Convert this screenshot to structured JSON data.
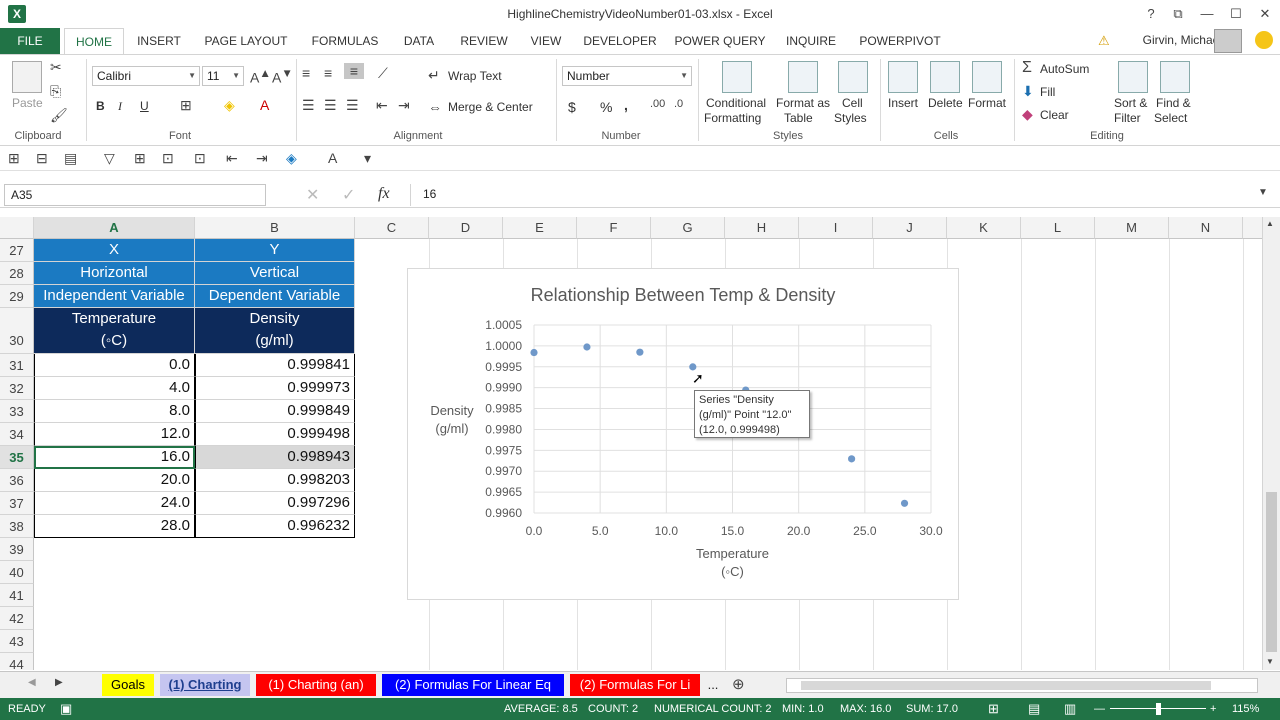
{
  "window": {
    "title": "HighlineChemistryVideoNumber01-03.xlsx - Excel",
    "help": "?",
    "restore": "⧉",
    "minimize": "—",
    "maximize": "☐",
    "close": "✕"
  },
  "ribbon_tabs": {
    "file": "FILE",
    "tabs": [
      "HOME",
      "INSERT",
      "PAGE LAYOUT",
      "FORMULAS",
      "DATA",
      "REVIEW",
      "VIEW",
      "DEVELOPER",
      "POWER QUERY",
      "INQUIRE",
      "POWERPIVOT"
    ],
    "user": "Girvin, Michael"
  },
  "ribbon": {
    "clipboard": {
      "paste": "Paste",
      "label": "Clipboard"
    },
    "font": {
      "name": "Calibri",
      "size": "11",
      "label": "Font",
      "bold": "B",
      "italic": "I",
      "underline": "U"
    },
    "alignment": {
      "wrap": "Wrap Text",
      "merge": "Merge & Center",
      "label": "Alignment"
    },
    "number": {
      "format": "Number",
      "label": "Number",
      "currency": "$",
      "percent": "%",
      "comma": ","
    },
    "styles": {
      "conditional": [
        "Conditional",
        "Formatting"
      ],
      "format_table": [
        "Format as",
        "Table"
      ],
      "cell_styles": [
        "Cell",
        "Styles"
      ],
      "label": "Styles"
    },
    "cells": {
      "insert": "Insert",
      "delete": "Delete",
      "format": "Format",
      "label": "Cells"
    },
    "editing": {
      "autosum": "AutoSum",
      "fill": "Fill",
      "clear": "Clear",
      "sort": [
        "Sort &",
        "Filter"
      ],
      "find": [
        "Find &",
        "Select"
      ],
      "label": "Editing"
    }
  },
  "formula_bar": {
    "name_box": "A35",
    "fx": "fx",
    "value": "16"
  },
  "columns": [
    "A",
    "B",
    "C",
    "D",
    "E",
    "F",
    "G",
    "H",
    "I",
    "J",
    "K",
    "L",
    "M",
    "N"
  ],
  "rows": [
    "27",
    "28",
    "29",
    "30",
    "31",
    "32",
    "33",
    "34",
    "35",
    "36",
    "37",
    "38",
    "39",
    "40",
    "41",
    "42",
    "43",
    "44"
  ],
  "table": {
    "r27": [
      "X",
      "Y"
    ],
    "r28": [
      "Horizontal",
      "Vertical"
    ],
    "r29": [
      "Independent Variable",
      "Dependent Variable"
    ],
    "r30a": [
      "Temperature",
      "Density"
    ],
    "r30b": [
      "(◦C)",
      "(g/ml)"
    ],
    "data": [
      [
        "0.0",
        "0.999841"
      ],
      [
        "4.0",
        "0.999973"
      ],
      [
        "8.0",
        "0.999849"
      ],
      [
        "12.0",
        "0.999498"
      ],
      [
        "16.0",
        "0.998943"
      ],
      [
        "20.0",
        "0.998203"
      ],
      [
        "24.0",
        "0.997296"
      ],
      [
        "28.0",
        "0.996232"
      ]
    ]
  },
  "chart_data": {
    "type": "scatter",
    "title": "Relationship Between Temp & Density",
    "xlabel_lines": [
      "Temperature",
      "(◦C)"
    ],
    "ylabel_lines": [
      "Density",
      "(g/ml)"
    ],
    "xlim": [
      0,
      30
    ],
    "ylim": [
      0.996,
      1.0005
    ],
    "x_ticks": [
      "0.0",
      "5.0",
      "10.0",
      "15.0",
      "20.0",
      "25.0",
      "30.0"
    ],
    "y_ticks": [
      "1.0005",
      "1.0000",
      "0.9995",
      "0.9990",
      "0.9985",
      "0.9980",
      "0.9975",
      "0.9970",
      "0.9965",
      "0.9960"
    ],
    "grid": true,
    "color": "#6f98c9",
    "series": [
      {
        "x": [
          0,
          4,
          8,
          12,
          16,
          20,
          24,
          28
        ],
        "y": [
          0.999841,
          0.999973,
          0.999849,
          0.999498,
          0.998943,
          0.998203,
          0.997296,
          0.996232
        ]
      }
    ]
  },
  "tooltip": {
    "line1": "Series \"Density",
    "line2": "(g/ml)\" Point \"12.0\"",
    "line3": "(12.0, 0.999498)"
  },
  "sheet_tabs": [
    {
      "label": "Goals",
      "bg": "#ffff00",
      "fg": "#000000"
    },
    {
      "label": "(1) Charting",
      "bg": "#c5c5f0",
      "fg": "#1f3f8f"
    },
    {
      "label": "(1) Charting (an)",
      "bg": "#ff0000",
      "fg": "#ffffff"
    },
    {
      "label": "(2) Formulas For Linear Eq",
      "bg": "#0000ff",
      "fg": "#ffffff"
    },
    {
      "label": "(2) Formulas For Li",
      "bg": "#ff0000",
      "fg": "#ffffff"
    }
  ],
  "sheet_more": "...",
  "status": {
    "ready": "READY",
    "average": "AVERAGE: 8.5",
    "count": "COUNT: 2",
    "num_count": "NUMERICAL COUNT: 2",
    "min": "MIN: 1.0",
    "max": "MAX: 16.0",
    "sum": "SUM: 17.0",
    "zoom": "115%"
  },
  "colors": {
    "excel_green": "#217346",
    "header_blue": "#1b7ac2",
    "header_navy": "#0d2a5b"
  }
}
